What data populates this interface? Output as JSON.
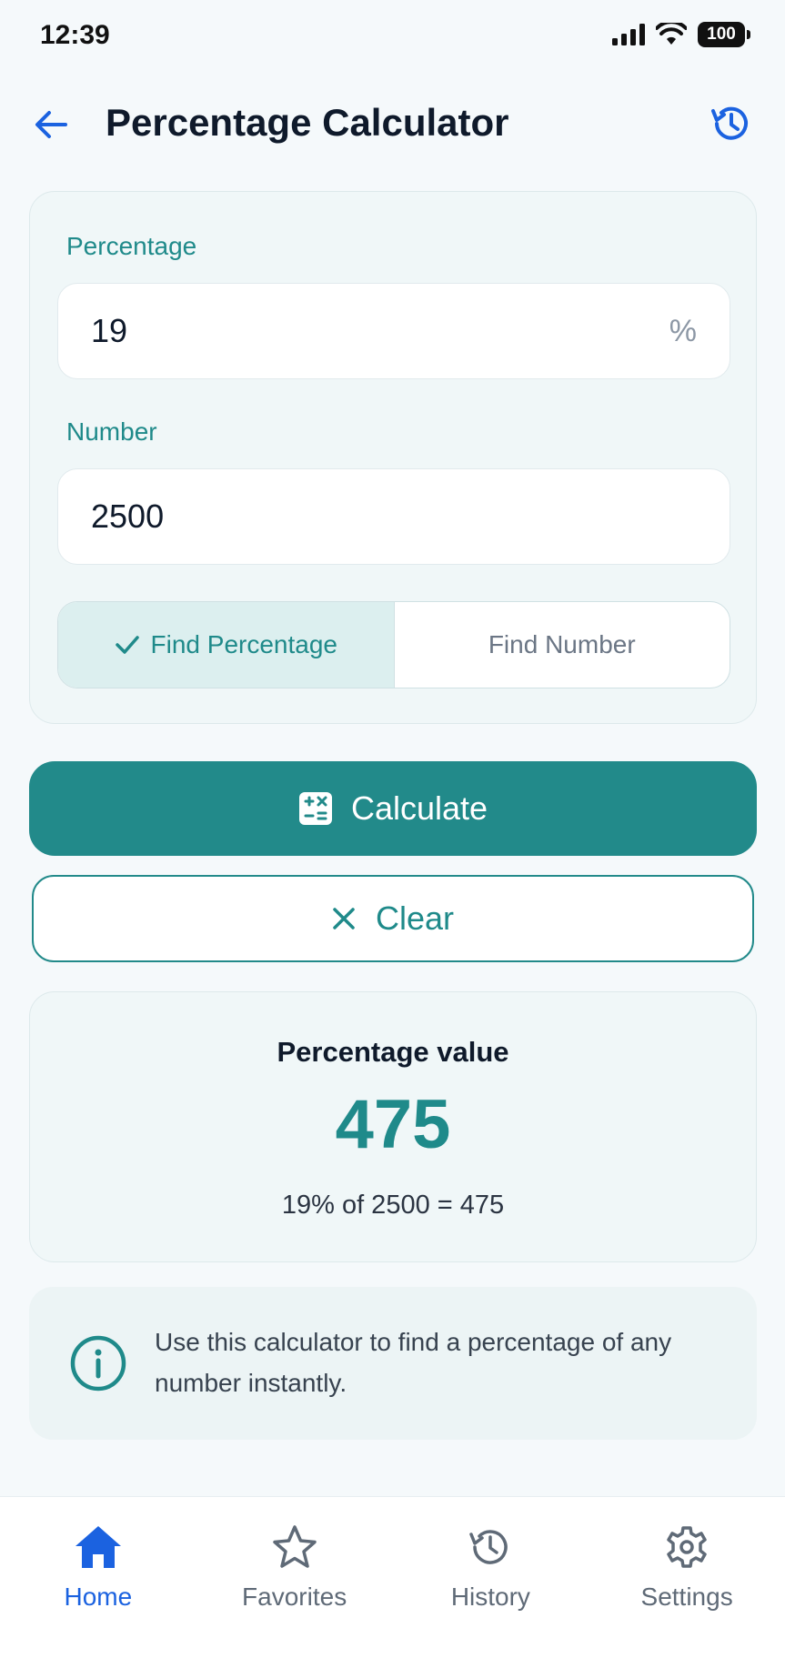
{
  "status": {
    "time": "12:39",
    "battery": "100"
  },
  "header": {
    "title": "Percentage Calculator"
  },
  "form": {
    "percentage_label": "Percentage",
    "percentage_value": "19",
    "percentage_suffix": "%",
    "number_label": "Number",
    "number_value": "2500",
    "mode_options": [
      "Find Percentage",
      "Find Number"
    ],
    "selected_mode": "Find Percentage"
  },
  "actions": {
    "calculate_label": "Calculate",
    "clear_label": "Clear"
  },
  "result": {
    "label": "Percentage value",
    "value": "475",
    "formula": "19% of 2500 = 475"
  },
  "info": {
    "text": "Use this calculator to find a percentage of any number instantly."
  },
  "tabs": [
    {
      "label": "Home",
      "icon": "home-icon",
      "active": true
    },
    {
      "label": "Favorites",
      "icon": "star-icon",
      "active": false
    },
    {
      "label": "History",
      "icon": "history-icon",
      "active": false
    },
    {
      "label": "Settings",
      "icon": "gear-icon",
      "active": false
    }
  ],
  "colors": {
    "accent": "#228a8a",
    "nav_active": "#1b62e0"
  }
}
